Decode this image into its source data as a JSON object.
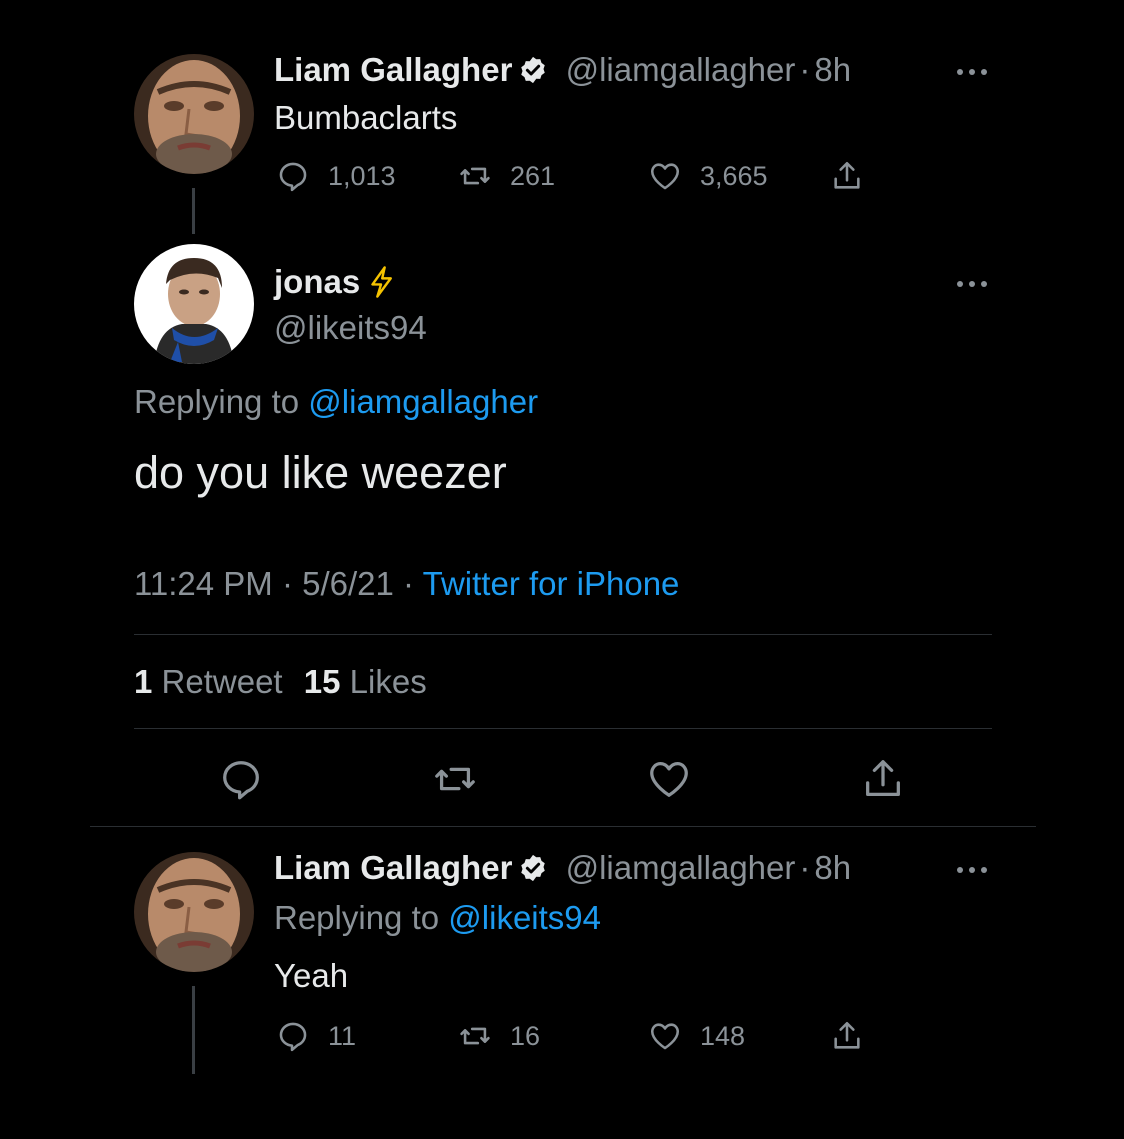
{
  "colors": {
    "background": "#000000",
    "text": "#e7e9ea",
    "muted": "#8b9298",
    "link": "#1d9bf0",
    "divider": "#2a2e32"
  },
  "tweet1": {
    "name": "Liam Gallagher",
    "handle": "@liamgallagher",
    "dot": "·",
    "time": "8h",
    "text": "Bumbaclarts",
    "replies": "1,013",
    "retweets": "261",
    "likes": "3,665"
  },
  "main_tweet": {
    "name": "jonas",
    "emoji_icon": "lightning-icon",
    "handle": "@likeits94",
    "replying_prefix": "Replying to",
    "replying_handle": "@liamgallagher",
    "text": "do you like weezer",
    "timestamp": "11:24 PM · 5/6/21 ·",
    "source": "Twitter for iPhone",
    "retweet_count": "1",
    "retweet_label": "Retweet",
    "like_count": "15",
    "like_label": "Likes"
  },
  "tweet3": {
    "name": "Liam Gallagher",
    "handle": "@liamgallagher",
    "dot": "·",
    "time": "8h",
    "replying_prefix": "Replying to",
    "replying_handle": "@likeits94",
    "text": "Yeah",
    "replies": "11",
    "retweets": "16",
    "likes": "148"
  }
}
